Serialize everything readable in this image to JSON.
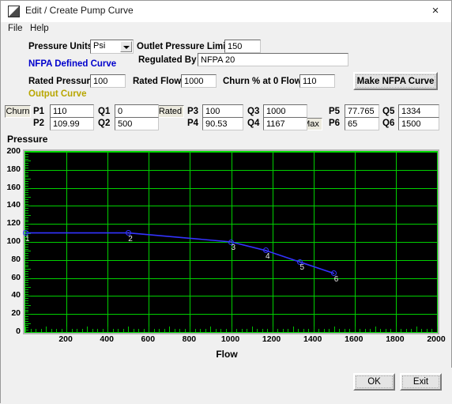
{
  "window": {
    "title": "Edit / Create Pump Curve",
    "icon": "pump-curve-icon",
    "close_label": "×"
  },
  "menu": {
    "items": [
      {
        "label": "File"
      },
      {
        "label": "Help"
      }
    ]
  },
  "form": {
    "pressure_units_label": "Pressure Units",
    "pressure_units_value": "Psi",
    "outlet_pressure_limit_label": "Outlet Pressure Limit",
    "outlet_pressure_limit_value": "150",
    "nfpa_defined_curve_label": "NFPA Defined Curve",
    "regulated_by_label": "Regulated By",
    "regulated_by_value": "NFPA 20",
    "rated_pressure_label": "Rated Pressure",
    "rated_pressure_value": "100",
    "rated_flow_label": "Rated Flow",
    "rated_flow_value": "1000",
    "churn_percent_label": "Churn %  at 0 Flow",
    "churn_percent_value": "110",
    "make_nfpa_curve_label": "Make NFPA Curve"
  },
  "output_curve": {
    "heading": "Output Curve",
    "churn_tag": "Churn",
    "rated_tag": "Rated",
    "max_tag": "Max",
    "pressures": [
      {
        "label": "P1",
        "value": "110"
      },
      {
        "label": "P2",
        "value": "109.99"
      },
      {
        "label": "P3",
        "value": "100"
      },
      {
        "label": "P4",
        "value": "90.53"
      },
      {
        "label": "P5",
        "value": "77.765"
      },
      {
        "label": "P6",
        "value": "65"
      }
    ],
    "flows": [
      {
        "label": "Q1",
        "value": "0"
      },
      {
        "label": "Q2",
        "value": "500"
      },
      {
        "label": "Q3",
        "value": "1000"
      },
      {
        "label": "Q4",
        "value": "1167"
      },
      {
        "label": "Q5",
        "value": "1334"
      },
      {
        "label": "Q6",
        "value": "1500"
      }
    ]
  },
  "buttons": {
    "ok_label": "OK",
    "exit_label": "Exit"
  },
  "chart_data": {
    "type": "line",
    "title": "",
    "xlabel": "Flow",
    "ylabel": "Pressure",
    "xlim": [
      0,
      2000
    ],
    "ylim": [
      0,
      200
    ],
    "xticks": [
      200,
      400,
      600,
      800,
      1000,
      1200,
      1400,
      1600,
      1800,
      2000
    ],
    "yticks": [
      0,
      20,
      40,
      60,
      80,
      100,
      120,
      140,
      160,
      180,
      200
    ],
    "grid": true,
    "legend": "none",
    "background": "#000000",
    "grid_color": "#00d000",
    "series": [
      {
        "name": "Output Curve",
        "color": "#3333ff",
        "x": [
          0,
          500,
          1000,
          1167,
          1334,
          1500
        ],
        "y": [
          110,
          109.99,
          100,
          90.53,
          77.765,
          65
        ],
        "point_labels": [
          "1",
          "2",
          "3",
          "4",
          "5",
          "6"
        ]
      }
    ]
  }
}
